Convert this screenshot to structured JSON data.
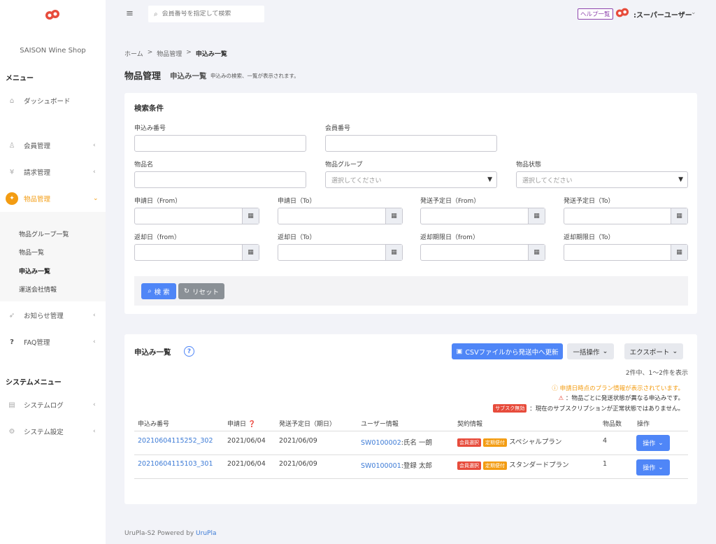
{
  "sidebar": {
    "shop_name": "SAISON Wine Shop",
    "menu_heading": "メニュー",
    "system_heading": "システムメニュー",
    "items": [
      {
        "label": "ダッシュボード",
        "icon": "home-icon"
      },
      {
        "label": "会員管理",
        "icon": "user-icon"
      },
      {
        "label": "請求管理",
        "icon": "yen-icon"
      },
      {
        "label": "物品管理",
        "icon": "goods-icon"
      },
      {
        "label": "お知らせ管理",
        "icon": "send-icon"
      },
      {
        "label": "FAQ管理",
        "icon": "question-icon"
      },
      {
        "label": "システムログ",
        "icon": "file-icon"
      },
      {
        "label": "システム設定",
        "icon": "settings-icon"
      }
    ],
    "sub_items": [
      "物品グループ一覧",
      "物品一覧",
      "申込み一覧",
      "運送会社情報"
    ]
  },
  "topbar": {
    "search_placeholder": "会員番号を指定して検索",
    "help_label": "ヘルプ一覧",
    "user_name": ":スーパーユーザー"
  },
  "breadcrumb": [
    "ホーム",
    ">",
    "物品管理",
    ">",
    "申込み一覧"
  ],
  "page": {
    "title": "物品管理",
    "subtitle": "申込み一覧",
    "description": "申込みの検索、一覧が表示されます。"
  },
  "search": {
    "title": "検索条件",
    "labels": {
      "order_no": "申込み番号",
      "member_no": "会員番号",
      "item_name": "物品名",
      "item_group": "物品グループ",
      "item_status": "物品状態",
      "apply_from": "申請日（From）",
      "apply_to": "申請日（To）",
      "ship_from": "発送予定日（From）",
      "ship_to": "発送予定日（To）",
      "return_from": "返却日（from）",
      "return_to": "返却日（To）",
      "deadline_from": "返却期限日（from）",
      "deadline_to": "返却期限日（To）"
    },
    "select_placeholder": "選択してください",
    "search_button": "検 索",
    "reset_button": "リセット"
  },
  "list": {
    "title": "申込み一覧",
    "csv_button": "CSVファイルから発送中へ更新",
    "bulk_button": "一括操作",
    "export_button": "エクスポート",
    "count_text": "2件中、1〜2件を表示",
    "note_plan": "申請日時点のプラン情報が表示されています。",
    "note_status": "：物品ごとに発送状態が異なる申込みです。",
    "note_subscription_tag": "サブスク無効",
    "note_subscription": "：現在のサブスクリプションが正常状態ではありません。",
    "headers": [
      "申込み番号",
      "申請日",
      "発送予定日（期日）",
      "ユーザー情報",
      "契約情報",
      "物品数",
      "操作"
    ],
    "rows": [
      {
        "order_no": "20210604115252_302",
        "apply_date": "2021/06/04",
        "ship_date": "2021/06/09",
        "user_id": "SW0100002",
        "user_name": ":氏名 一朗",
        "tag1": "会員選択",
        "tag2": "定期便付",
        "plan": "スペシャルプラン",
        "count": "4",
        "action": "操作"
      },
      {
        "order_no": "20210604115103_301",
        "apply_date": "2021/06/04",
        "ship_date": "2021/06/09",
        "user_id": "SW0100001",
        "user_name": ":登録 太郎",
        "tag1": "会員選択",
        "tag2": "定期便付",
        "plan": "スタンダードプラン",
        "count": "1",
        "action": "操作"
      }
    ]
  },
  "footer": {
    "text": "UruPla-S2 Powered by",
    "link": "UruPla"
  },
  "colors": {
    "accent": "#f39c12",
    "primary": "#4f86f7",
    "brand_red": "#e74c3c"
  }
}
